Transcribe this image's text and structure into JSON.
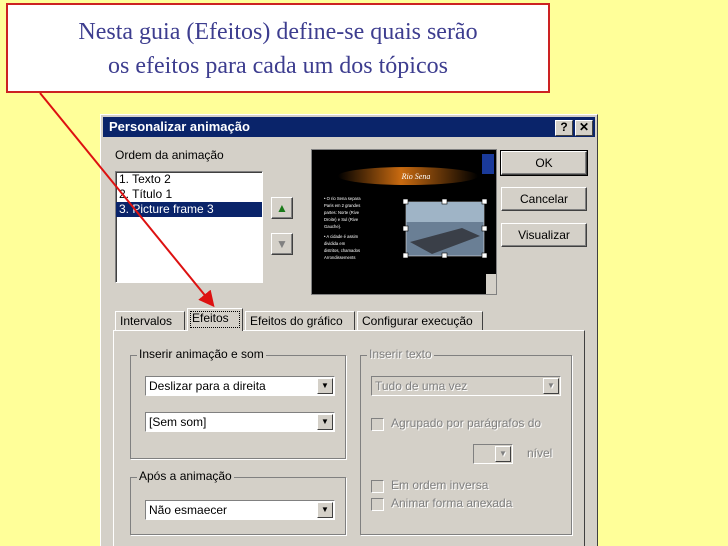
{
  "callout": {
    "line1": "Nesta guia (Efeitos) define-se quais serão",
    "line2": "os efeitos para cada um dos tópicos"
  },
  "dialog": {
    "title": "Personalizar animação",
    "help_label": "?",
    "close_label": "✕",
    "order_label": "Ordem da animação",
    "order_items": [
      "1. Texto 2",
      "2. Título 1",
      "3. Picture frame 3"
    ],
    "selected_index": 2,
    "buttons": {
      "ok": "OK",
      "cancel": "Cancelar",
      "preview": "Visualizar"
    },
    "preview": {
      "slide_title": "Rio Sena",
      "bullet1": "O rio Sena separa Paris em 2 grandes partes: Norte (Rive Droite) e Sul (Rive Gauche).",
      "bullet2": "A cidade é assim dividida em distritos, chamados Arrondissements"
    },
    "tabs": [
      "Intervalos",
      "Efeitos",
      "Efeitos do gráfico",
      "Configurar execução"
    ],
    "active_tab": "Efeitos",
    "effects": {
      "insert_group": "Inserir animação e som",
      "animation_value": "Deslizar para a direita",
      "sound_value": "[Sem som]",
      "after_group": "Após a animação",
      "after_value": "Não esmaecer",
      "text_group": "Inserir texto",
      "text_value": "Tudo de uma vez",
      "grouped_label": "Agrupado por parágrafos do",
      "level_label": "nível",
      "reverse_label": "Em ordem inversa",
      "animate_shape_label": "Animar forma anexada"
    }
  },
  "colors": {
    "background": "#ffff99",
    "titlebar": "#0a246a",
    "callout_text": "#3d3d8f",
    "callout_border": "#cc2222",
    "arrow": "#dd1111"
  }
}
